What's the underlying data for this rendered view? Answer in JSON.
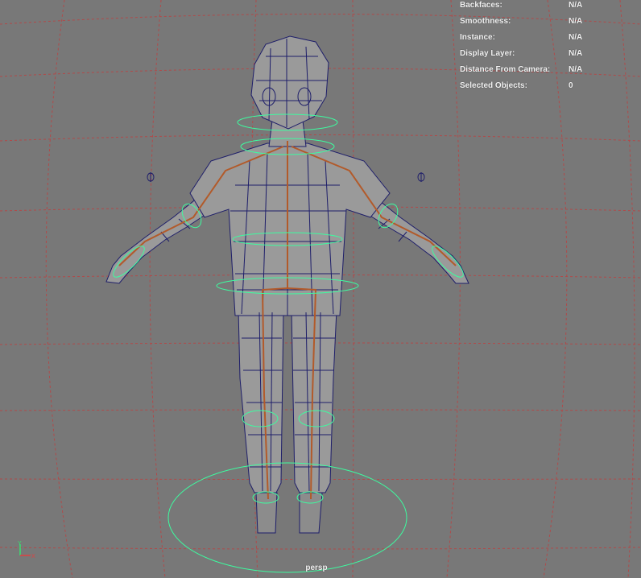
{
  "viewport": {
    "camera_label": "persp",
    "hud": [
      {
        "label": "Backfaces:",
        "value": "N/A"
      },
      {
        "label": "Smoothness:",
        "value": "N/A"
      },
      {
        "label": "Instance:",
        "value": "N/A"
      },
      {
        "label": "Display Layer:",
        "value": "N/A"
      },
      {
        "label": "Distance From Camera:",
        "value": "N/A"
      },
      {
        "label": "Selected Objects:",
        "value": "0"
      }
    ],
    "axis": {
      "y_label": "Y",
      "x_label": "X"
    },
    "colors": {
      "background": "#787878",
      "grid": "#b04a4a",
      "mesh_fill": "#9a9a9a",
      "wireframe": "#1e1e6a",
      "controls": "#3dfca0",
      "skeleton": "#b25a2a"
    }
  }
}
